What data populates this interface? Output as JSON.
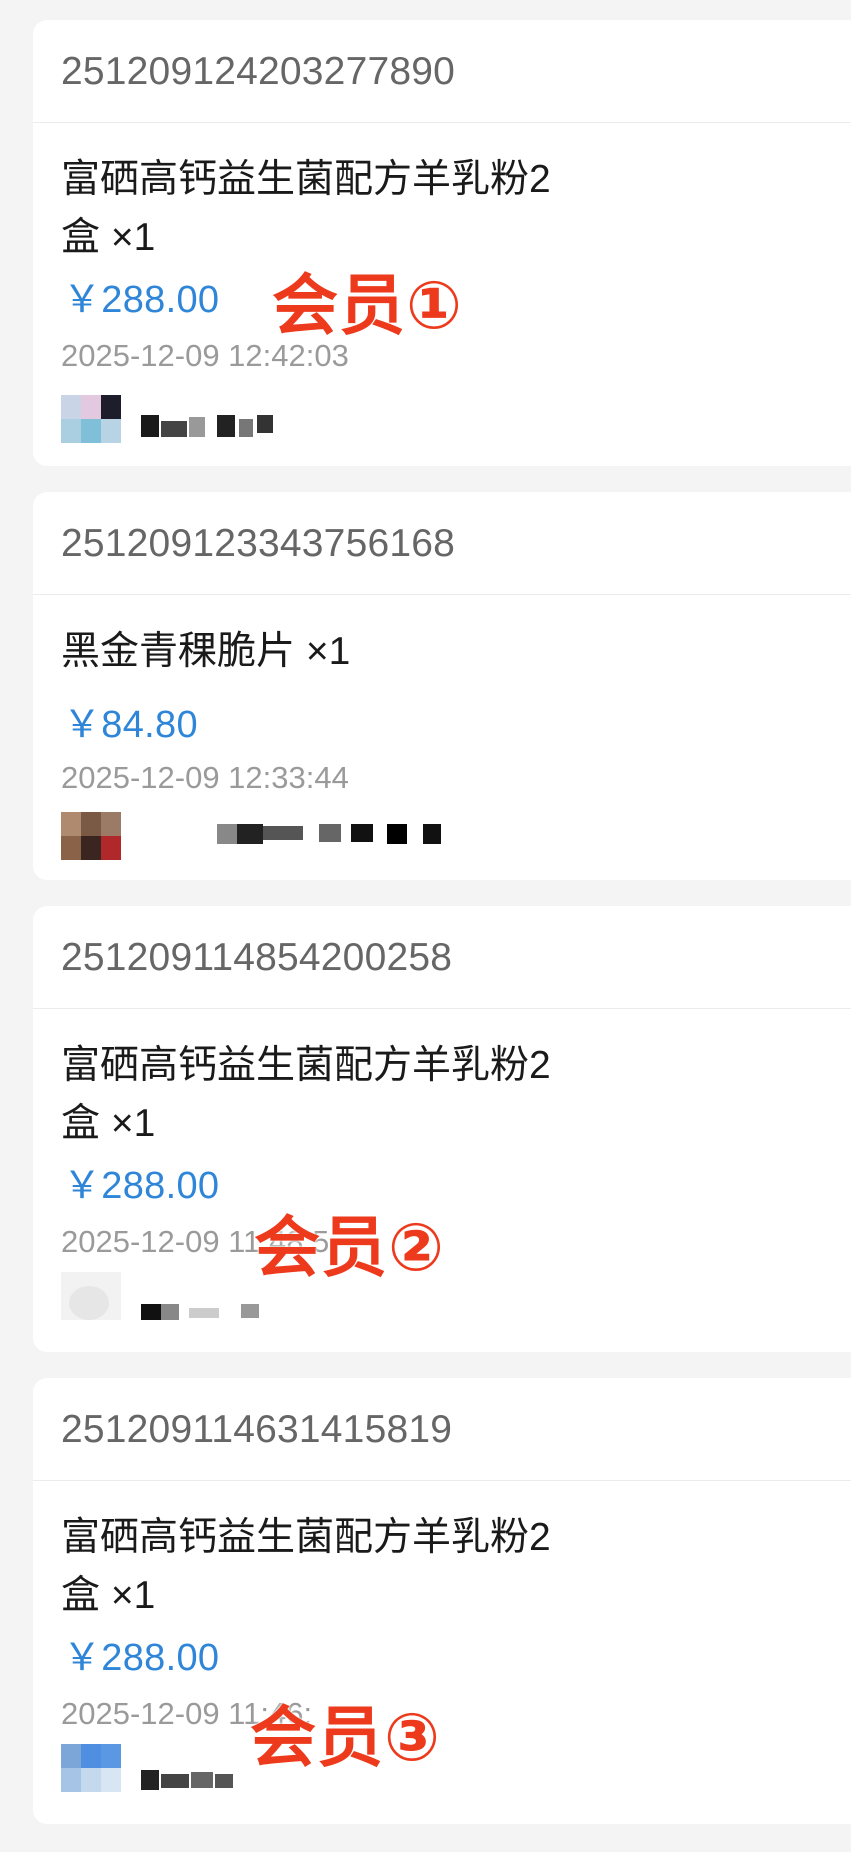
{
  "orders": [
    {
      "order_no": "251209124203277890",
      "product": "富硒高钙益生菌配方羊乳粉2盒 ×1",
      "price": "￥288.00",
      "datetime": "2025-12-09 12:42:03",
      "member_tag": "会员①"
    },
    {
      "order_no": "251209123343756168",
      "product": "黑金青稞脆片 ×1",
      "price": "￥84.80",
      "datetime": "2025-12-09 12:33:44"
    },
    {
      "order_no": "251209114854200258",
      "product": "富硒高钙益生菌配方羊乳粉2盒 ×1",
      "price": "￥288.00",
      "datetime": "2025-12-09 11:48:5",
      "member_tag": "会员②"
    },
    {
      "order_no": "251209114631415819",
      "product": "富硒高钙益生菌配方羊乳粉2盒 ×1",
      "price": "￥288.00",
      "datetime": "2025-12-09 11:46:",
      "member_tag": "会员③"
    }
  ]
}
